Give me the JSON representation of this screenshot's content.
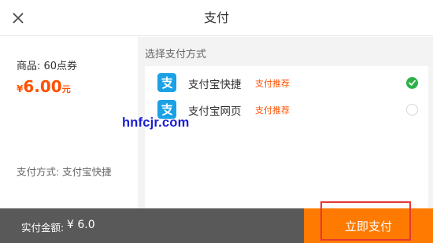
{
  "header": {
    "title": "支付",
    "close_icon": "close-icon"
  },
  "order": {
    "product_label": "商品: 60点券",
    "price_currency": "¥",
    "price_amount": "6.00",
    "price_unit": "元",
    "pay_method_summary": "支付方式:  支付宝快捷"
  },
  "methods": {
    "section_label": "选择支付方式",
    "options": [
      {
        "name": "支付宝快捷",
        "tag": "支付推荐",
        "selected": true,
        "icon": "alipay-icon"
      },
      {
        "name": "支付宝网页",
        "tag": "支付推荐",
        "selected": false,
        "icon": "alipay-icon"
      }
    ]
  },
  "watermark": "hnfcjr.com",
  "footer": {
    "total_label": "实付金额:",
    "total_value": "¥ 6.0",
    "pay_button_label": "立即支付"
  },
  "colors": {
    "accent": "#ff7a00",
    "price": "#ff5000",
    "alipay": "#1aa1e6",
    "check": "#2eb14b",
    "footer_bg": "#595959",
    "highlight": "#e53935"
  }
}
